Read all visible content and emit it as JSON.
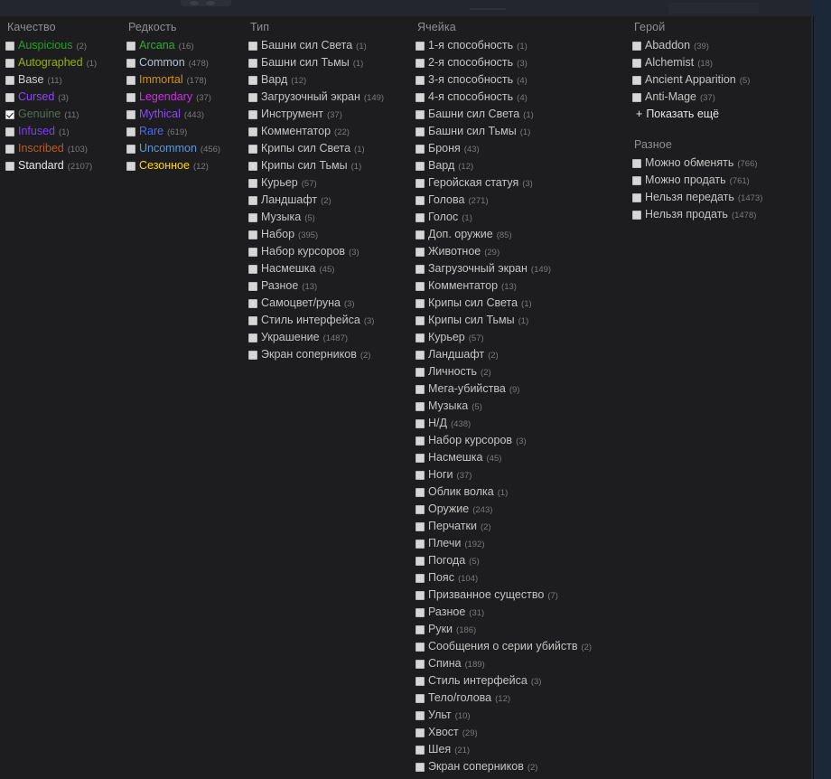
{
  "colors": {
    "page_background": "#1b2838",
    "panel_background": "#1d1d1f",
    "label_default": "#c4c4c4",
    "count": "#7a7a7a",
    "group_title": "#8f8f8f"
  },
  "groups": [
    {
      "id": "quality",
      "title": "Качество",
      "options": [
        {
          "label": "Auspicious",
          "count": "(2)",
          "color": "#1fa21f",
          "checked": false
        },
        {
          "label": "Autographed",
          "count": "(1)",
          "color": "#95b300",
          "checked": false
        },
        {
          "label": "Base",
          "count": "(11)",
          "color": "#d2d2d2",
          "checked": false
        },
        {
          "label": "Cursed",
          "count": "(3)",
          "color": "#8847ff",
          "checked": false
        },
        {
          "label": "Genuine",
          "count": "(11)",
          "color": "#4d7455",
          "checked": true
        },
        {
          "label": "Infused",
          "count": "(1)",
          "color": "#7c3cff",
          "checked": false
        },
        {
          "label": "Inscribed",
          "count": "(103)",
          "color": "#c05a1e",
          "checked": false
        },
        {
          "label": "Standard",
          "count": "(2107)",
          "color": "#e6e6e6",
          "checked": false
        }
      ]
    },
    {
      "id": "rarity",
      "title": "Редкость",
      "options": [
        {
          "label": "Arcana",
          "count": "(16)",
          "color": "#2aaf2a",
          "checked": false
        },
        {
          "label": "Common",
          "count": "(478)",
          "color": "#b0c3d9",
          "checked": false
        },
        {
          "label": "Immortal",
          "count": "(178)",
          "color": "#d0901a",
          "checked": false
        },
        {
          "label": "Legendary",
          "count": "(37)",
          "color": "#d32ce6",
          "checked": false
        },
        {
          "label": "Mythical",
          "count": "(443)",
          "color": "#8847ff",
          "checked": false
        },
        {
          "label": "Rare",
          "count": "(619)",
          "color": "#4b69ff",
          "checked": false
        },
        {
          "label": "Uncommon",
          "count": "(456)",
          "color": "#5e98d9",
          "checked": false
        },
        {
          "label": "Сезонное",
          "count": "(12)",
          "color": "#ffd700",
          "checked": false
        }
      ]
    },
    {
      "id": "type",
      "title": "Тип",
      "options": [
        {
          "label": "Башни сил Света",
          "count": "(1)",
          "checked": false
        },
        {
          "label": "Башни сил Тьмы",
          "count": "(1)",
          "checked": false
        },
        {
          "label": "Вард",
          "count": "(12)",
          "checked": false
        },
        {
          "label": "Загрузочный экран",
          "count": "(149)",
          "checked": false
        },
        {
          "label": "Инструмент",
          "count": "(37)",
          "checked": false
        },
        {
          "label": "Комментатор",
          "count": "(22)",
          "checked": false
        },
        {
          "label": "Крипы сил Света",
          "count": "(1)",
          "checked": false
        },
        {
          "label": "Крипы сил Тьмы",
          "count": "(1)",
          "checked": false
        },
        {
          "label": "Курьер",
          "count": "(57)",
          "checked": false
        },
        {
          "label": "Ландшафт",
          "count": "(2)",
          "checked": false
        },
        {
          "label": "Музыка",
          "count": "(5)",
          "checked": false
        },
        {
          "label": "Набор",
          "count": "(395)",
          "checked": false
        },
        {
          "label": "Набор курсоров",
          "count": "(3)",
          "checked": false
        },
        {
          "label": "Насмешка",
          "count": "(45)",
          "checked": false
        },
        {
          "label": "Разное",
          "count": "(13)",
          "checked": false
        },
        {
          "label": "Самоцвет/руна",
          "count": "(3)",
          "checked": false
        },
        {
          "label": "Стиль интерфейса",
          "count": "(3)",
          "checked": false
        },
        {
          "label": "Украшение",
          "count": "(1487)",
          "checked": false
        },
        {
          "label": "Экран соперников",
          "count": "(2)",
          "checked": false
        }
      ]
    },
    {
      "id": "slot",
      "title": "Ячейка",
      "options": [
        {
          "label": "1-я способность",
          "count": "(1)",
          "checked": false
        },
        {
          "label": "2-я способность",
          "count": "(3)",
          "checked": false
        },
        {
          "label": "3-я способность",
          "count": "(4)",
          "checked": false
        },
        {
          "label": "4-я способность",
          "count": "(4)",
          "checked": false
        },
        {
          "label": "Башни сил Света",
          "count": "(1)",
          "checked": false
        },
        {
          "label": "Башни сил Тьмы",
          "count": "(1)",
          "checked": false
        },
        {
          "label": "Броня",
          "count": "(43)",
          "checked": false
        },
        {
          "label": "Вард",
          "count": "(12)",
          "checked": false
        },
        {
          "label": "Геройская статуя",
          "count": "(3)",
          "checked": false
        },
        {
          "label": "Голова",
          "count": "(271)",
          "checked": false
        },
        {
          "label": "Голос",
          "count": "(1)",
          "checked": false
        },
        {
          "label": "Доп. оружие",
          "count": "(85)",
          "checked": false
        },
        {
          "label": "Животное",
          "count": "(29)",
          "checked": false
        },
        {
          "label": "Загрузочный экран",
          "count": "(149)",
          "checked": false
        },
        {
          "label": "Комментатор",
          "count": "(13)",
          "checked": false
        },
        {
          "label": "Крипы сил Света",
          "count": "(1)",
          "checked": false
        },
        {
          "label": "Крипы сил Тьмы",
          "count": "(1)",
          "checked": false
        },
        {
          "label": "Курьер",
          "count": "(57)",
          "checked": false
        },
        {
          "label": "Ландшафт",
          "count": "(2)",
          "checked": false
        },
        {
          "label": "Личность",
          "count": "(2)",
          "checked": false
        },
        {
          "label": "Мега-убийства",
          "count": "(9)",
          "checked": false
        },
        {
          "label": "Музыка",
          "count": "(5)",
          "checked": false
        },
        {
          "label": "Н/Д",
          "count": "(438)",
          "checked": false
        },
        {
          "label": "Набор курсоров",
          "count": "(3)",
          "checked": false
        },
        {
          "label": "Насмешка",
          "count": "(45)",
          "checked": false
        },
        {
          "label": "Ноги",
          "count": "(37)",
          "checked": false
        },
        {
          "label": "Облик волка",
          "count": "(1)",
          "checked": false
        },
        {
          "label": "Оружие",
          "count": "(243)",
          "checked": false
        },
        {
          "label": "Перчатки",
          "count": "(2)",
          "checked": false
        },
        {
          "label": "Плечи",
          "count": "(192)",
          "checked": false
        },
        {
          "label": "Погода",
          "count": "(5)",
          "checked": false
        },
        {
          "label": "Пояс",
          "count": "(104)",
          "checked": false
        },
        {
          "label": "Призванное существо",
          "count": "(7)",
          "checked": false
        },
        {
          "label": "Разное",
          "count": "(31)",
          "checked": false
        },
        {
          "label": "Руки",
          "count": "(186)",
          "checked": false
        },
        {
          "label": "Сообщения о серии убийств",
          "count": "(2)",
          "checked": false
        },
        {
          "label": "Спина",
          "count": "(189)",
          "checked": false
        },
        {
          "label": "Стиль интерфейса",
          "count": "(3)",
          "checked": false
        },
        {
          "label": "Тело/голова",
          "count": "(12)",
          "checked": false
        },
        {
          "label": "Ульт",
          "count": "(10)",
          "checked": false
        },
        {
          "label": "Хвост",
          "count": "(29)",
          "checked": false
        },
        {
          "label": "Шея",
          "count": "(21)",
          "checked": false
        },
        {
          "label": "Экран соперников",
          "count": "(2)",
          "checked": false
        }
      ]
    },
    {
      "id": "hero",
      "title": "Герой",
      "show_more_label": "Показать ещё",
      "show_more_plus": "+",
      "options": [
        {
          "label": "Abaddon",
          "count": "(39)",
          "checked": false
        },
        {
          "label": "Alchemist",
          "count": "(18)",
          "checked": false
        },
        {
          "label": "Ancient Apparition",
          "count": "(5)",
          "checked": false
        },
        {
          "label": "Anti-Mage",
          "count": "(37)",
          "checked": false
        }
      ]
    },
    {
      "id": "misc",
      "title": "Разное",
      "options": [
        {
          "label": "Можно обменять",
          "count": "(766)",
          "checked": false
        },
        {
          "label": "Можно продать",
          "count": "(761)",
          "checked": false
        },
        {
          "label": "Нельзя передать",
          "count": "(1473)",
          "checked": false
        },
        {
          "label": "Нельзя продать",
          "count": "(1478)",
          "checked": false
        }
      ]
    }
  ]
}
